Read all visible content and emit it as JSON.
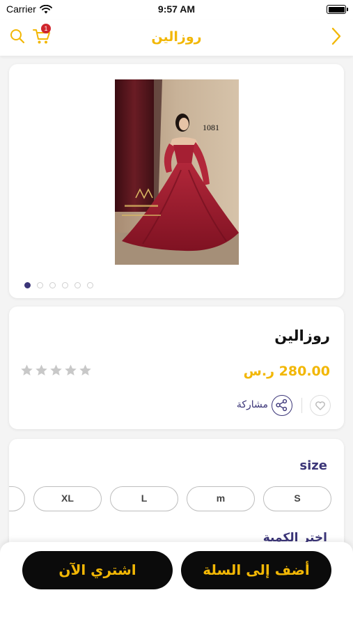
{
  "status_bar": {
    "carrier": "Carrier",
    "time": "9:57 AM"
  },
  "nav": {
    "title": "روزالين",
    "cart_count": "1",
    "accent_color": "#f2b705",
    "icons": [
      "search-icon",
      "cart-icon",
      "chevron-right-icon"
    ]
  },
  "gallery": {
    "image_label": "1081",
    "slide_count": 6,
    "active_slide": 1
  },
  "product": {
    "title": "روزالين",
    "price": "280.00 ر.س",
    "rating": 0,
    "rating_max": 5,
    "share_label": "مشاركة"
  },
  "options": {
    "size_heading": "size",
    "sizes": [
      "S",
      "m",
      "L",
      "XL"
    ],
    "quantity_heading": "اختر الكمية"
  },
  "actions": {
    "add_to_cart": "أضف إلى السلة",
    "buy_now": "اشتري الآن"
  }
}
